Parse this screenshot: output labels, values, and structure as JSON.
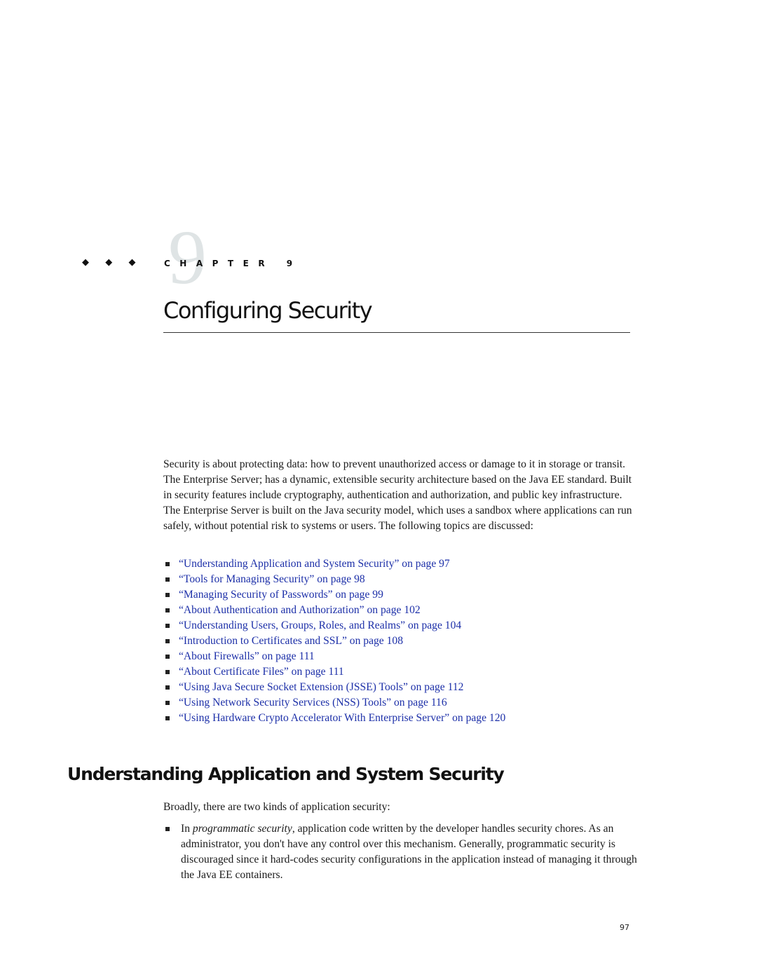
{
  "chapter": {
    "ornament": "◆ ◆ ◆",
    "number_glyph": "9",
    "label": "CHAPTER 9",
    "title": "Configuring Security"
  },
  "intro": {
    "paragraph": "Security is about protecting data: how to prevent unauthorized access or damage to it in storage or transit. The Enterprise Server; has a dynamic, extensible security architecture based on the Java EE standard. Built in security features include cryptography, authentication and authorization, and public key infrastructure. The Enterprise Server is built on the Java security model, which uses a sandbox where applications can run safely, without potential risk to systems or users. The following topics are discussed:"
  },
  "topics": [
    {
      "label": "“Understanding Application and System Security” on page 97"
    },
    {
      "label": "“Tools for Managing Security” on page 98"
    },
    {
      "label": "“Managing Security of Passwords” on page 99"
    },
    {
      "label": "“About Authentication and Authorization” on page 102"
    },
    {
      "label": "“Understanding Users, Groups, Roles, and Realms” on page 104"
    },
    {
      "label": "“Introduction to Certificates and SSL” on page 108"
    },
    {
      "label": "“About Firewalls” on page 111"
    },
    {
      "label": "“About Certificate Files” on page 111"
    },
    {
      "label": "“Using Java Secure Socket Extension (JSSE) Tools” on page 112"
    },
    {
      "label": "“Using Network Security Services (NSS) Tools” on page 116"
    },
    {
      "label": "“Using Hardware Crypto Accelerator With Enterprise Server” on page 120"
    }
  ],
  "section": {
    "title": "Understanding Application and System Security",
    "lead": "Broadly, there are two kinds of application security:",
    "items": [
      {
        "prefix": "In ",
        "emphasis": "programmatic security",
        "text": ", application code written by the developer handles security chores. As an administrator, you don't have any control over this mechanism. Generally, programmatic security is discouraged since it hard-codes security configurations in the application instead of managing it through the Java EE containers."
      }
    ]
  },
  "footer": {
    "page_number": "97"
  },
  "colors": {
    "link": "#1c2fa8",
    "text": "#1a1a1a",
    "chapter_numeral": "#dfe4e5"
  }
}
